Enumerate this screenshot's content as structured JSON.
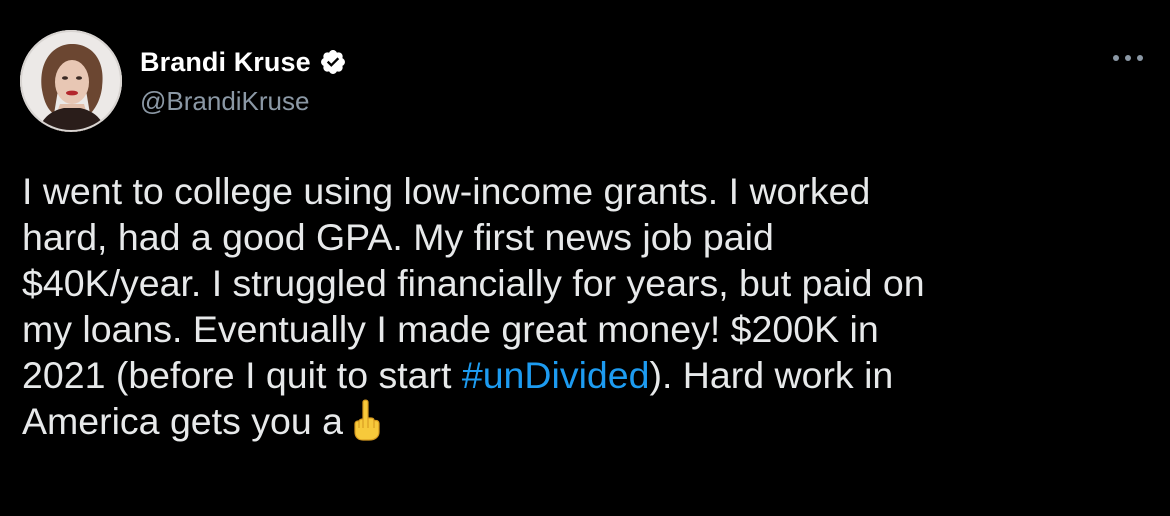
{
  "author": {
    "display_name": "Brandi Kruse",
    "handle": "@BrandiKruse",
    "verified_icon": "verified-badge-icon",
    "avatar_icon": "profile-photo"
  },
  "menu": {
    "icon": "more-options-icon"
  },
  "tweet": {
    "lines": [
      "I went to college using low-income grants. I worked",
      "hard, had a good GPA. My first news job paid",
      "$40K/year. I struggled financially for years, but paid on",
      "my loans. Eventually I made great money! $200K in"
    ],
    "line5_before": "2021 (before I quit to start ",
    "hashtag": "#unDivided",
    "line5_after": "). Hard work in",
    "line6": "America gets you a",
    "emoji_icon": "middle-finger-emoji-icon"
  },
  "colors": {
    "background": "#000000",
    "text": "#e7e9ea",
    "secondary": "#8b98a5",
    "link": "#1d9bf0"
  }
}
